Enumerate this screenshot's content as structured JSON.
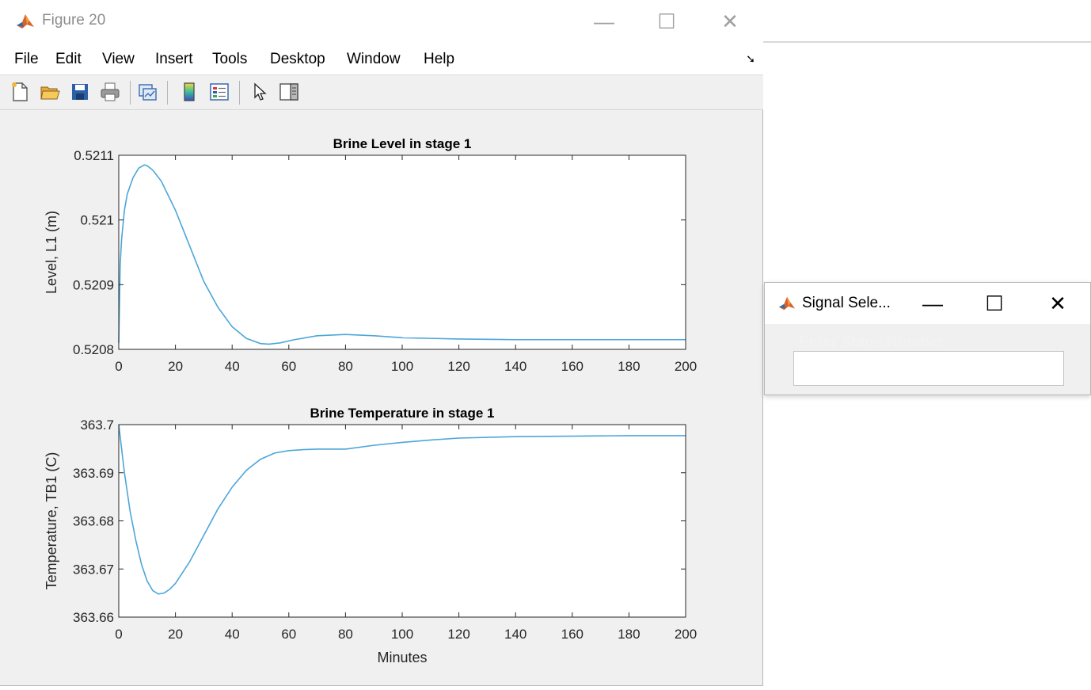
{
  "figure_window": {
    "title": "Figure 20",
    "controls": {
      "minimize": "—",
      "maximize": "☐",
      "close": "✕"
    },
    "menu": [
      "File",
      "Edit",
      "View",
      "Insert",
      "Tools",
      "Desktop",
      "Window",
      "Help"
    ],
    "menu_arrow": "➘",
    "toolbar_icons": [
      "new-figure-icon",
      "open-file-icon",
      "save-icon",
      "print-icon",
      "link-plot-icon",
      "colorbar-icon",
      "legend-icon",
      "edit-plot-arrow-icon",
      "property-editor-icon"
    ]
  },
  "dialog": {
    "title": "Signal Sele...",
    "controls": {
      "minimize": "—",
      "maximize": "☐",
      "close": "✕"
    },
    "label": "Enter Stage Number",
    "input_value": ""
  },
  "colors": {
    "line": "#4da6d9",
    "axes": "#262626",
    "figure_bg": "#f0f0f0"
  },
  "chart_data": [
    {
      "type": "line",
      "title": "Brine Level in stage 1",
      "xlabel": "",
      "ylabel": "Level,  L1  (m)",
      "xlim": [
        0,
        200
      ],
      "ylim": [
        0.5208,
        0.5211
      ],
      "xticks": [
        0,
        20,
        40,
        60,
        80,
        100,
        120,
        140,
        160,
        180,
        200
      ],
      "xtick_labels": [
        "0",
        "20",
        "40",
        "60",
        "80",
        "100",
        "120",
        "140",
        "160",
        "180",
        "200"
      ],
      "yticks": [
        0.5208,
        0.5209,
        0.521,
        0.5211
      ],
      "ytick_labels": [
        "0.5208",
        "0.5209",
        "0.521",
        "0.5211"
      ],
      "grid": false,
      "series": [
        {
          "x": [
            0,
            0.5,
            1,
            2,
            3,
            5,
            7,
            9,
            10,
            12,
            15,
            20,
            25,
            30,
            35,
            40,
            45,
            50,
            53,
            57,
            62,
            70,
            80,
            90,
            100,
            110,
            120,
            140,
            160,
            180,
            200
          ],
          "y": [
            0.52081,
            0.52093,
            0.52097,
            0.521015,
            0.52104,
            0.521065,
            0.52108,
            0.521085,
            0.521084,
            0.521077,
            0.52106,
            0.521015,
            0.52096,
            0.520905,
            0.520865,
            0.520835,
            0.520817,
            0.520809,
            0.520808,
            0.52081,
            0.520815,
            0.520821,
            0.520823,
            0.520821,
            0.520818,
            0.520817,
            0.520816,
            0.520815,
            0.520815,
            0.520815,
            0.520815
          ]
        }
      ]
    },
    {
      "type": "line",
      "title": "Brine Temperature in stage 1",
      "xlabel": "Minutes",
      "ylabel": "Temperature,  TB1  (C)",
      "xlim": [
        0,
        200
      ],
      "ylim": [
        363.66,
        363.7
      ],
      "xticks": [
        0,
        20,
        40,
        60,
        80,
        100,
        120,
        140,
        160,
        180,
        200
      ],
      "xtick_labels": [
        "0",
        "20",
        "40",
        "60",
        "80",
        "100",
        "120",
        "140",
        "160",
        "180",
        "200"
      ],
      "yticks": [
        363.66,
        363.67,
        363.68,
        363.69,
        363.7
      ],
      "ytick_labels": [
        "363.66",
        "363.67",
        "363.68",
        "363.69",
        "363.7"
      ],
      "grid": false,
      "series": [
        {
          "x": [
            0,
            1,
            2,
            4,
            6,
            8,
            10,
            12,
            14,
            16,
            18,
            20,
            25,
            30,
            35,
            40,
            45,
            50,
            55,
            60,
            65,
            70,
            80,
            90,
            100,
            110,
            120,
            140,
            160,
            180,
            200
          ],
          "y": [
            363.7,
            363.695,
            363.69,
            363.682,
            363.676,
            363.671,
            363.6675,
            363.6655,
            363.6648,
            363.665,
            363.6658,
            363.667,
            363.6715,
            363.677,
            363.6825,
            363.687,
            363.6905,
            363.6928,
            363.6941,
            363.6946,
            363.6948,
            363.6949,
            363.6949,
            363.6957,
            363.6963,
            363.6968,
            363.6972,
            363.6975,
            363.6976,
            363.6977,
            363.6977
          ]
        }
      ]
    }
  ]
}
